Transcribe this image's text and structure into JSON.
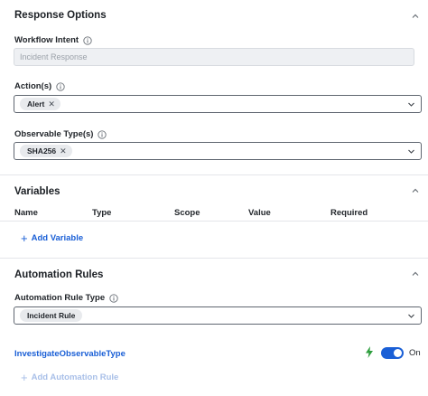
{
  "response_options": {
    "title": "Response Options",
    "workflow_intent": {
      "label": "Workflow Intent",
      "placeholder": "Incident Response"
    },
    "actions": {
      "label": "Action(s)",
      "chips": [
        "Alert"
      ]
    },
    "observable_types": {
      "label": "Observable Type(s)",
      "chips": [
        "SHA256"
      ]
    }
  },
  "variables": {
    "title": "Variables",
    "columns": [
      "Name",
      "Type",
      "Scope",
      "Value",
      "Required"
    ],
    "add_label": "Add Variable"
  },
  "automation_rules": {
    "title": "Automation Rules",
    "rule_type": {
      "label": "Automation Rule Type",
      "chip": "Incident Rule"
    },
    "rule_name": "InvestigateObservableType",
    "toggle_state": "On",
    "toggle_on": true,
    "add_label": "Add Automation Rule"
  },
  "icons": {
    "collapse": "chevron-up-icon",
    "info": "info-icon",
    "dropdown": "chevron-down-icon",
    "remove": "close-icon",
    "add": "plus-icon",
    "status": "lightning-bolt-icon"
  },
  "colors": {
    "link": "#1a5fd6",
    "toggle": "#1a5fd6",
    "bolt": "#2e9e3e"
  }
}
